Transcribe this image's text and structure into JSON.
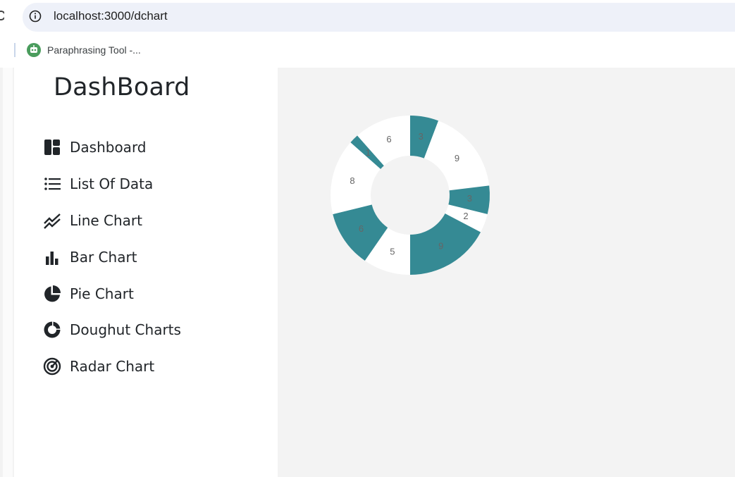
{
  "browser": {
    "url": "localhost:3000/dchart",
    "bookmark_label": "Paraphrasing Tool -...",
    "info_icon": "info-icon",
    "bookmark_favicon": "robot-icon"
  },
  "sidebar": {
    "brand": "DashBoard",
    "items": [
      {
        "label": "Dashboard",
        "icon": "dashboard-icon"
      },
      {
        "label": "List Of Data",
        "icon": "list-icon"
      },
      {
        "label": "Line Chart",
        "icon": "line-chart-icon"
      },
      {
        "label": "Bar Chart",
        "icon": "bar-chart-icon"
      },
      {
        "label": "Pie Chart",
        "icon": "pie-chart-icon"
      },
      {
        "label": "Doughut Charts",
        "icon": "donut-chart-icon"
      },
      {
        "label": "Radar Chart",
        "icon": "radar-chart-icon"
      }
    ]
  },
  "colors": {
    "teal": "#358a94",
    "white": "#ffffff",
    "main_bg": "#f3f3f3",
    "label": "#666666"
  },
  "chart_data": {
    "type": "doughnut",
    "values": [
      3,
      9,
      3,
      2,
      9,
      5,
      6,
      8,
      1,
      6
    ],
    "colors": [
      "#358a94",
      "#ffffff",
      "#358a94",
      "#ffffff",
      "#358a94",
      "#ffffff",
      "#358a94",
      "#ffffff",
      "#358a94",
      "#ffffff"
    ],
    "labels": [
      "3",
      "9",
      "3",
      "2",
      "9",
      "5",
      "6",
      "8",
      "1",
      "6"
    ],
    "start_angle_deg": 0,
    "direction": "clockwise",
    "legend": "none"
  }
}
